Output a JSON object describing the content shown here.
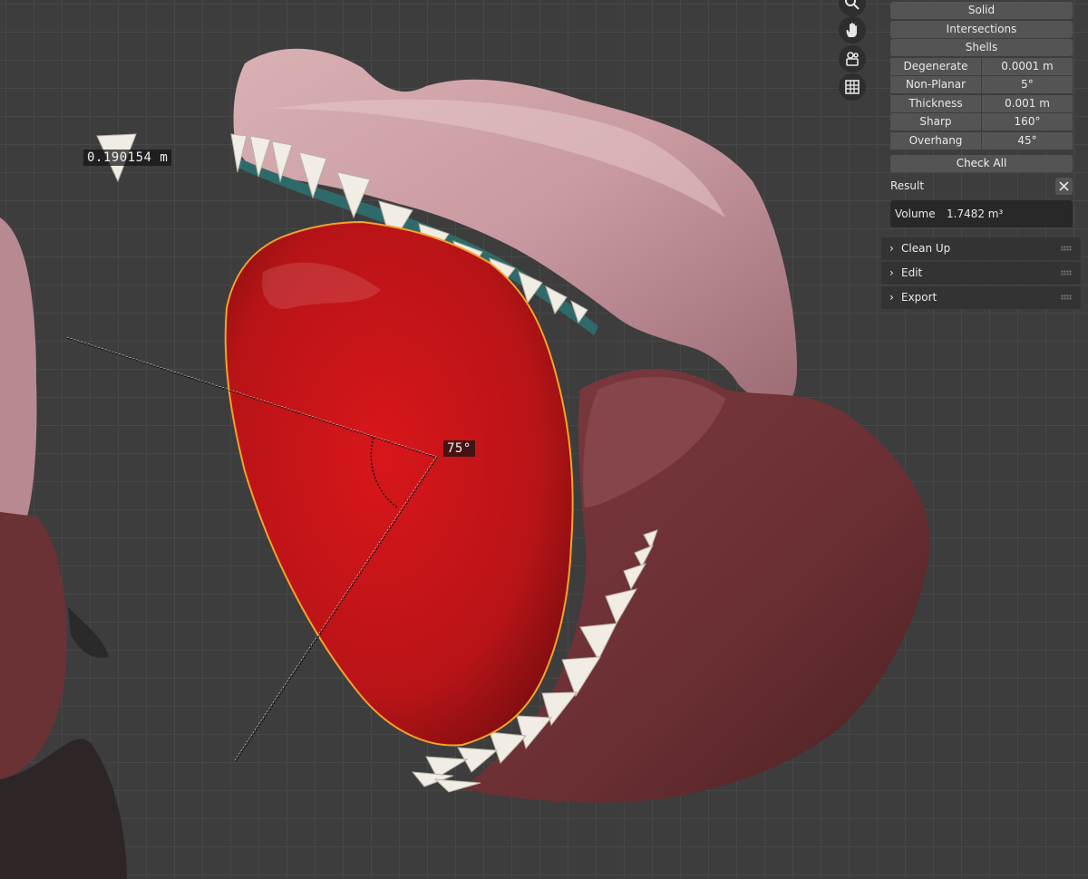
{
  "viewport": {
    "length_measure": "0.190154 m",
    "angle_measure": "75°"
  },
  "nav_gizmo": {
    "buttons": [
      "zoom-icon",
      "hand-pan-icon",
      "camera-icon",
      "grid-icon"
    ]
  },
  "panel": {
    "toggles": [
      "Solid",
      "Intersections",
      "Shells"
    ],
    "checks": [
      {
        "label": "Degenerate",
        "value": "0.0001 m"
      },
      {
        "label": "Non-Planar",
        "value": "5°"
      },
      {
        "label": "Thickness",
        "value": "0.001 m"
      },
      {
        "label": "Sharp",
        "value": "160°"
      },
      {
        "label": "Overhang",
        "value": "45°"
      }
    ],
    "check_all": "Check All",
    "result": {
      "label": "Result",
      "key": "Volume",
      "value": "1.7482 m³"
    },
    "sections": [
      "Clean Up",
      "Edit",
      "Export"
    ]
  },
  "colors": {
    "grid_bg": "#3d3d3d",
    "tongue": "#c8181a",
    "selection_outline": "#f5a22a",
    "upper_jaw": "#c49aa0",
    "lower_jaw": "#6a2f33"
  }
}
